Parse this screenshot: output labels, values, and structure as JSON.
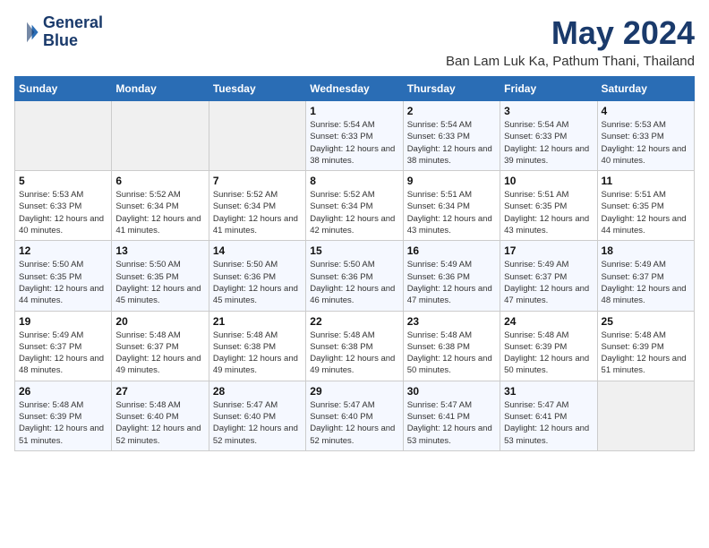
{
  "header": {
    "logo_line1": "General",
    "logo_line2": "Blue",
    "month": "May 2024",
    "location": "Ban Lam Luk Ka, Pathum Thani, Thailand"
  },
  "days_of_week": [
    "Sunday",
    "Monday",
    "Tuesday",
    "Wednesday",
    "Thursday",
    "Friday",
    "Saturday"
  ],
  "weeks": [
    [
      {
        "day": "",
        "info": ""
      },
      {
        "day": "",
        "info": ""
      },
      {
        "day": "",
        "info": ""
      },
      {
        "day": "1",
        "info": "Sunrise: 5:54 AM\nSunset: 6:33 PM\nDaylight: 12 hours\nand 38 minutes."
      },
      {
        "day": "2",
        "info": "Sunrise: 5:54 AM\nSunset: 6:33 PM\nDaylight: 12 hours\nand 38 minutes."
      },
      {
        "day": "3",
        "info": "Sunrise: 5:54 AM\nSunset: 6:33 PM\nDaylight: 12 hours\nand 39 minutes."
      },
      {
        "day": "4",
        "info": "Sunrise: 5:53 AM\nSunset: 6:33 PM\nDaylight: 12 hours\nand 40 minutes."
      }
    ],
    [
      {
        "day": "5",
        "info": "Sunrise: 5:53 AM\nSunset: 6:33 PM\nDaylight: 12 hours\nand 40 minutes."
      },
      {
        "day": "6",
        "info": "Sunrise: 5:52 AM\nSunset: 6:34 PM\nDaylight: 12 hours\nand 41 minutes."
      },
      {
        "day": "7",
        "info": "Sunrise: 5:52 AM\nSunset: 6:34 PM\nDaylight: 12 hours\nand 41 minutes."
      },
      {
        "day": "8",
        "info": "Sunrise: 5:52 AM\nSunset: 6:34 PM\nDaylight: 12 hours\nand 42 minutes."
      },
      {
        "day": "9",
        "info": "Sunrise: 5:51 AM\nSunset: 6:34 PM\nDaylight: 12 hours\nand 43 minutes."
      },
      {
        "day": "10",
        "info": "Sunrise: 5:51 AM\nSunset: 6:35 PM\nDaylight: 12 hours\nand 43 minutes."
      },
      {
        "day": "11",
        "info": "Sunrise: 5:51 AM\nSunset: 6:35 PM\nDaylight: 12 hours\nand 44 minutes."
      }
    ],
    [
      {
        "day": "12",
        "info": "Sunrise: 5:50 AM\nSunset: 6:35 PM\nDaylight: 12 hours\nand 44 minutes."
      },
      {
        "day": "13",
        "info": "Sunrise: 5:50 AM\nSunset: 6:35 PM\nDaylight: 12 hours\nand 45 minutes."
      },
      {
        "day": "14",
        "info": "Sunrise: 5:50 AM\nSunset: 6:36 PM\nDaylight: 12 hours\nand 45 minutes."
      },
      {
        "day": "15",
        "info": "Sunrise: 5:50 AM\nSunset: 6:36 PM\nDaylight: 12 hours\nand 46 minutes."
      },
      {
        "day": "16",
        "info": "Sunrise: 5:49 AM\nSunset: 6:36 PM\nDaylight: 12 hours\nand 47 minutes."
      },
      {
        "day": "17",
        "info": "Sunrise: 5:49 AM\nSunset: 6:37 PM\nDaylight: 12 hours\nand 47 minutes."
      },
      {
        "day": "18",
        "info": "Sunrise: 5:49 AM\nSunset: 6:37 PM\nDaylight: 12 hours\nand 48 minutes."
      }
    ],
    [
      {
        "day": "19",
        "info": "Sunrise: 5:49 AM\nSunset: 6:37 PM\nDaylight: 12 hours\nand 48 minutes."
      },
      {
        "day": "20",
        "info": "Sunrise: 5:48 AM\nSunset: 6:37 PM\nDaylight: 12 hours\nand 49 minutes."
      },
      {
        "day": "21",
        "info": "Sunrise: 5:48 AM\nSunset: 6:38 PM\nDaylight: 12 hours\nand 49 minutes."
      },
      {
        "day": "22",
        "info": "Sunrise: 5:48 AM\nSunset: 6:38 PM\nDaylight: 12 hours\nand 49 minutes."
      },
      {
        "day": "23",
        "info": "Sunrise: 5:48 AM\nSunset: 6:38 PM\nDaylight: 12 hours\nand 50 minutes."
      },
      {
        "day": "24",
        "info": "Sunrise: 5:48 AM\nSunset: 6:39 PM\nDaylight: 12 hours\nand 50 minutes."
      },
      {
        "day": "25",
        "info": "Sunrise: 5:48 AM\nSunset: 6:39 PM\nDaylight: 12 hours\nand 51 minutes."
      }
    ],
    [
      {
        "day": "26",
        "info": "Sunrise: 5:48 AM\nSunset: 6:39 PM\nDaylight: 12 hours\nand 51 minutes."
      },
      {
        "day": "27",
        "info": "Sunrise: 5:48 AM\nSunset: 6:40 PM\nDaylight: 12 hours\nand 52 minutes."
      },
      {
        "day": "28",
        "info": "Sunrise: 5:47 AM\nSunset: 6:40 PM\nDaylight: 12 hours\nand 52 minutes."
      },
      {
        "day": "29",
        "info": "Sunrise: 5:47 AM\nSunset: 6:40 PM\nDaylight: 12 hours\nand 52 minutes."
      },
      {
        "day": "30",
        "info": "Sunrise: 5:47 AM\nSunset: 6:41 PM\nDaylight: 12 hours\nand 53 minutes."
      },
      {
        "day": "31",
        "info": "Sunrise: 5:47 AM\nSunset: 6:41 PM\nDaylight: 12 hours\nand 53 minutes."
      },
      {
        "day": "",
        "info": ""
      }
    ]
  ]
}
